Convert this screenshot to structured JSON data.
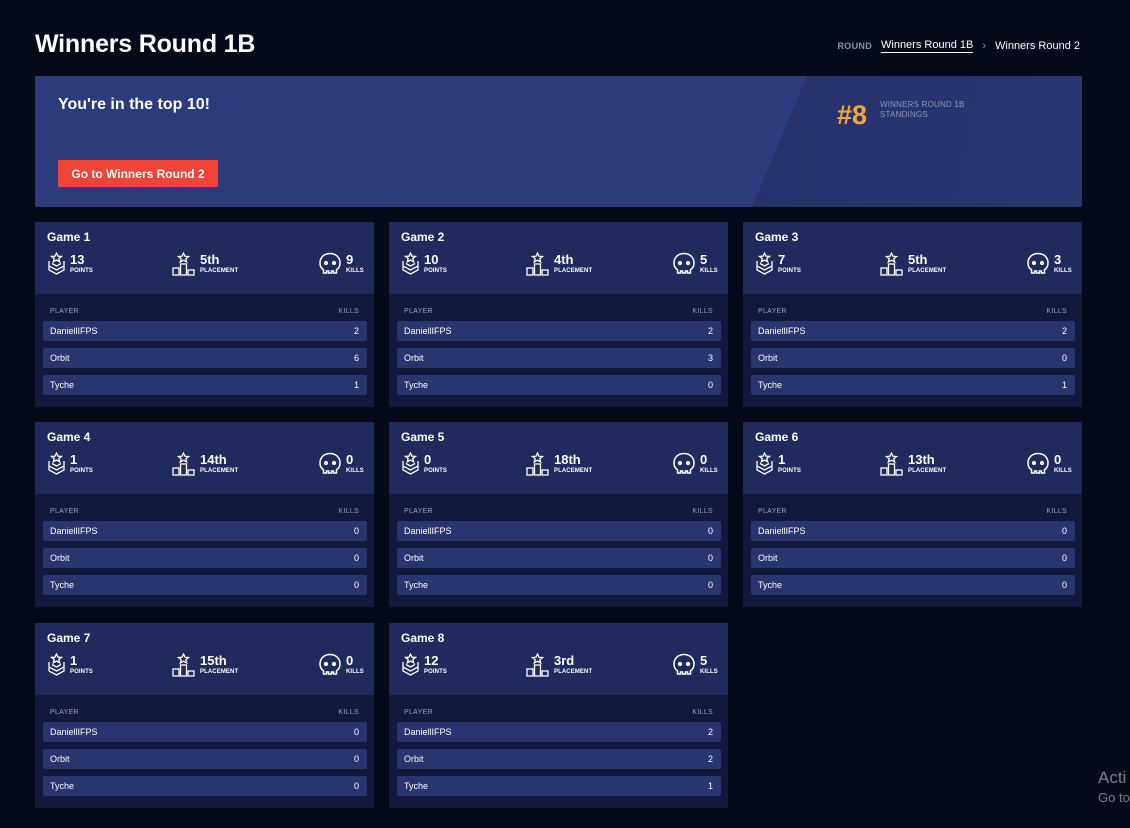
{
  "header": {
    "title": "Winners Round 1B",
    "breadcrumb": {
      "label": "ROUND",
      "current": "Winners Round 1B",
      "next": "Winners Round 2"
    }
  },
  "banner": {
    "heading": "You're in the top 10!",
    "button_label": "Go to Winners Round 2",
    "rank": "#8",
    "rank_label_line1": "WINNERS ROUND 1B",
    "rank_label_line2": "STANDINGS",
    "rank_color": "#f3a83c",
    "button_color": "#f14436"
  },
  "labels": {
    "points": "POINTS",
    "placement": "PLACEMENT",
    "kills": "KILLS",
    "player": "PLAYER"
  },
  "games": [
    {
      "title": "Game 1",
      "points": "13",
      "placement": "5th",
      "kills": "9",
      "players": [
        {
          "name": "DaniellIFPS",
          "kills": "2"
        },
        {
          "name": "Orbit",
          "kills": "6"
        },
        {
          "name": "Tyche",
          "kills": "1"
        }
      ]
    },
    {
      "title": "Game 2",
      "points": "10",
      "placement": "4th",
      "kills": "5",
      "players": [
        {
          "name": "DaniellIFPS",
          "kills": "2"
        },
        {
          "name": "Orbit",
          "kills": "3"
        },
        {
          "name": "Tyche",
          "kills": "0"
        }
      ]
    },
    {
      "title": "Game 3",
      "points": "7",
      "placement": "5th",
      "kills": "3",
      "players": [
        {
          "name": "DaniellIFPS",
          "kills": "2"
        },
        {
          "name": "Orbit",
          "kills": "0"
        },
        {
          "name": "Tyche",
          "kills": "1"
        }
      ]
    },
    {
      "title": "Game 4",
      "points": "1",
      "placement": "14th",
      "kills": "0",
      "players": [
        {
          "name": "DaniellIFPS",
          "kills": "0"
        },
        {
          "name": "Orbit",
          "kills": "0"
        },
        {
          "name": "Tyche",
          "kills": "0"
        }
      ]
    },
    {
      "title": "Game 5",
      "points": "0",
      "placement": "18th",
      "kills": "0",
      "players": [
        {
          "name": "DaniellIFPS",
          "kills": "0"
        },
        {
          "name": "Orbit",
          "kills": "0"
        },
        {
          "name": "Tyche",
          "kills": "0"
        }
      ]
    },
    {
      "title": "Game 6",
      "points": "1",
      "placement": "13th",
      "kills": "0",
      "players": [
        {
          "name": "DaniellIFPS",
          "kills": "0"
        },
        {
          "name": "Orbit",
          "kills": "0"
        },
        {
          "name": "Tyche",
          "kills": "0"
        }
      ]
    },
    {
      "title": "Game 7",
      "points": "1",
      "placement": "15th",
      "kills": "0",
      "players": [
        {
          "name": "DaniellIFPS",
          "kills": "0"
        },
        {
          "name": "Orbit",
          "kills": "0"
        },
        {
          "name": "Tyche",
          "kills": "0"
        }
      ]
    },
    {
      "title": "Game 8",
      "points": "12",
      "placement": "3rd",
      "kills": "5",
      "players": [
        {
          "name": "DaniellIFPS",
          "kills": "2"
        },
        {
          "name": "Orbit",
          "kills": "2"
        },
        {
          "name": "Tyche",
          "kills": "1"
        }
      ]
    }
  ],
  "icons": {
    "points": "chevron-rank-icon",
    "placement": "podium-icon",
    "kills": "skull-icon"
  },
  "watermark": {
    "line1": "Acti",
    "line2": "Go to"
  }
}
